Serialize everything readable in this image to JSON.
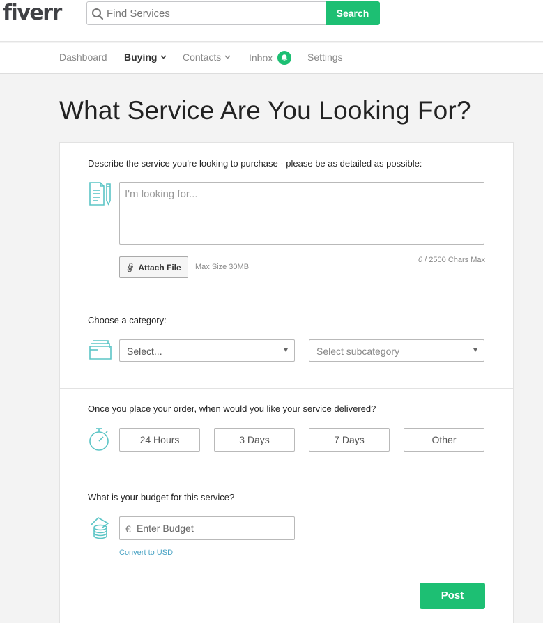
{
  "header": {
    "logo": "fiverr",
    "search_placeholder": "Find Services",
    "search_button": "Search"
  },
  "nav": {
    "items": [
      {
        "label": "Dashboard"
      },
      {
        "label": "Buying"
      },
      {
        "label": "Contacts"
      },
      {
        "label": "Inbox"
      },
      {
        "label": "Settings"
      }
    ]
  },
  "page": {
    "title": "What Service Are You Looking For?"
  },
  "description": {
    "label": "Describe the service you're looking to purchase - please be as detailed as possible:",
    "placeholder": "I'm looking for...",
    "attach_label": "Attach File",
    "max_size": "Max Size 30MB",
    "char_current": "0",
    "char_max": " / 2500 Chars Max"
  },
  "category": {
    "label": "Choose a category:",
    "category_value": "Select...",
    "subcategory_value": "Select subcategory"
  },
  "delivery": {
    "label": "Once you place your order, when would you like your service delivered?",
    "options": [
      "24 Hours",
      "3 Days",
      "7 Days",
      "Other"
    ]
  },
  "budget": {
    "label": "What is your budget for this service?",
    "currency_symbol": "€",
    "placeholder": "Enter Budget",
    "convert_label": "Convert to USD",
    "post_label": "Post"
  },
  "colors": {
    "accent": "#1dbf73",
    "icon": "#5cc5c6",
    "link": "#4aa3c4"
  }
}
